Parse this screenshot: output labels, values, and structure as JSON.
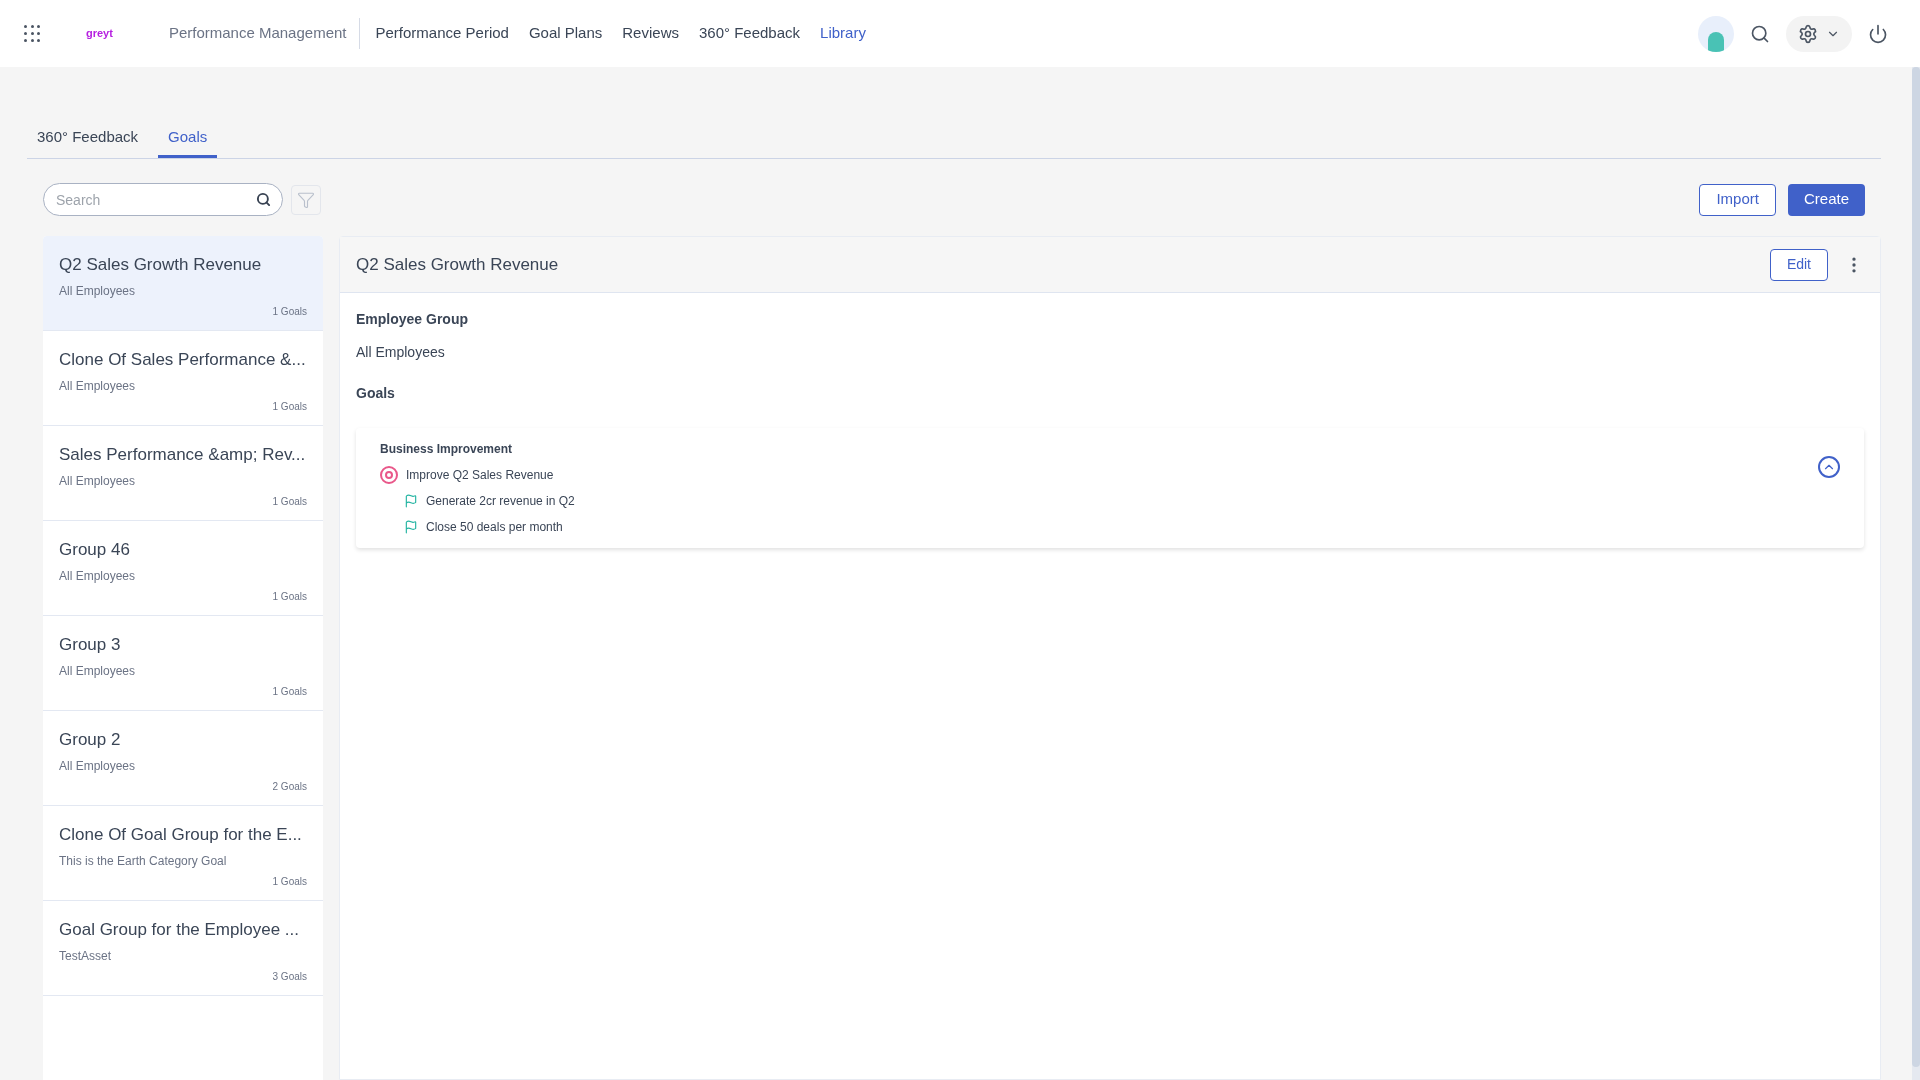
{
  "header": {
    "logo": "greyt",
    "module": "Performance Management",
    "nav": [
      {
        "label": "Performance Period",
        "selected": false
      },
      {
        "label": "Goal Plans",
        "selected": false
      },
      {
        "label": "Reviews",
        "selected": false
      },
      {
        "label": "360° Feedback",
        "selected": false
      },
      {
        "label": "Library",
        "selected": true
      }
    ]
  },
  "tabs": [
    {
      "label": "360° Feedback",
      "selected": false
    },
    {
      "label": "Goals",
      "selected": true
    }
  ],
  "search": {
    "placeholder": "Search"
  },
  "buttons": {
    "import": "Import",
    "create": "Create"
  },
  "groups": [
    {
      "title": "Q2 Sales Growth Revenue",
      "subtitle": "All Employees",
      "count": "1 Goals",
      "selected": true
    },
    {
      "title": "Clone Of Sales Performance &...",
      "subtitle": "All Employees",
      "count": "1 Goals",
      "selected": false
    },
    {
      "title": "Sales Performance &amp; Rev...",
      "subtitle": "All Employees",
      "count": "1 Goals",
      "selected": false
    },
    {
      "title": "Group 46",
      "subtitle": "All Employees",
      "count": "1 Goals",
      "selected": false
    },
    {
      "title": "Group 3",
      "subtitle": "All Employees",
      "count": "1 Goals",
      "selected": false
    },
    {
      "title": "Group 2",
      "subtitle": "All Employees",
      "count": "2 Goals",
      "selected": false
    },
    {
      "title": "Clone Of Goal Group for the E...",
      "subtitle": "This is the Earth Category Goal",
      "count": "1 Goals",
      "selected": false
    },
    {
      "title": "Goal Group for the Employee ...",
      "subtitle": "TestAsset",
      "count": "3 Goals",
      "selected": false
    }
  ],
  "detail": {
    "title": "Q2 Sales Growth Revenue",
    "edit": "Edit",
    "employee_group_label": "Employee Group",
    "employee_group": "All Employees",
    "goals_label": "Goals",
    "goals": [
      {
        "category": "Business Improvement",
        "expanded": true,
        "goal": "Improve Q2 Sales Revenue",
        "children": [
          {
            "label": "Generate 2cr revenue in Q2"
          },
          {
            "label": "Close 50 deals per month"
          }
        ]
      }
    ]
  }
}
